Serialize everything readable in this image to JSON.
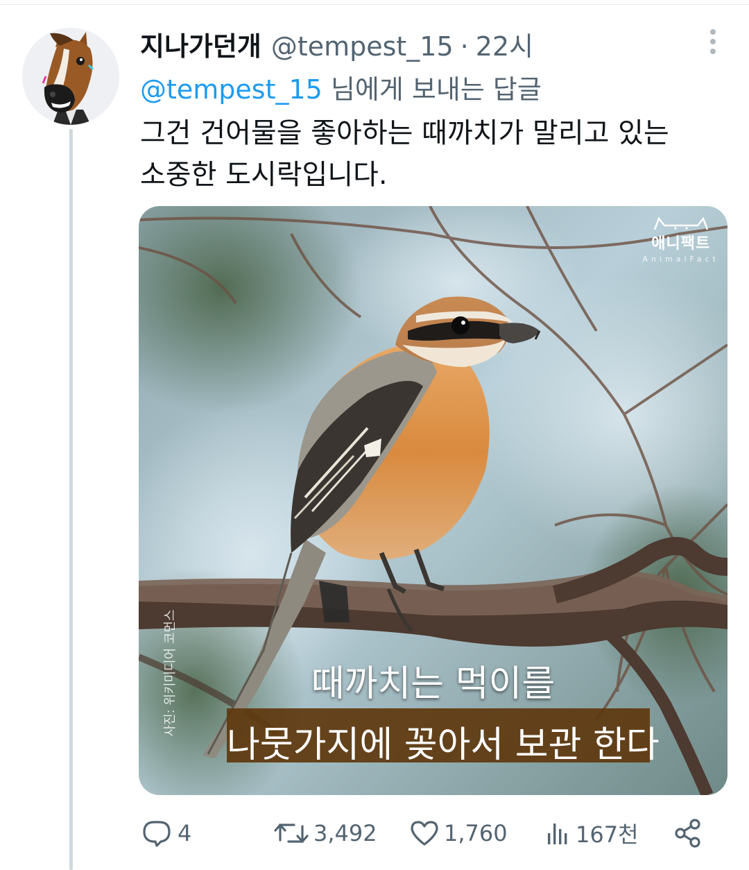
{
  "tweet": {
    "display_name": "지나가던개",
    "handle": "@tempest_15",
    "separator": "·",
    "time": "22시",
    "reply_mention": "@tempest_15",
    "reply_suffix": " 님에게 보내는 답글",
    "text_line1": "그건 건어물을 좋아하는 때까치가 말리고 있는",
    "text_line2": "소중한 도시락입니다."
  },
  "media": {
    "brand_name": "애니팩트",
    "brand_sub": "AnimalFact",
    "credit": "사진: 위키미디어 코먼스",
    "caption_line1": "때까치는 먹이를",
    "caption_line2": "나뭇가지에 꽂아서 보관 한다"
  },
  "actions": {
    "reply_count": "4",
    "retweet_count": "3,492",
    "like_count": "1,760",
    "views_count": "167천"
  },
  "colors": {
    "accent": "#1d9bf0",
    "secondary_text": "#536471",
    "caption_box": "#5e380e"
  }
}
